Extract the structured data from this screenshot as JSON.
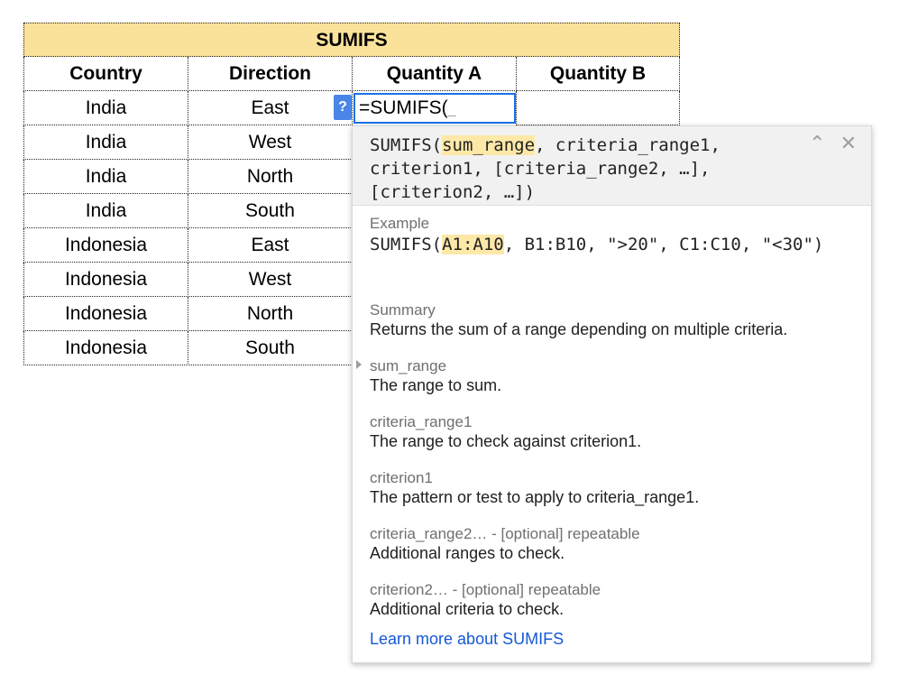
{
  "sheet": {
    "title": "SUMIFS",
    "headers": [
      "Country",
      "Direction",
      "Quantity A",
      "Quantity B"
    ],
    "rows": [
      [
        "India",
        "East"
      ],
      [
        "India",
        "West"
      ],
      [
        "India",
        "North"
      ],
      [
        "India",
        "South"
      ],
      [
        "Indonesia",
        "East"
      ],
      [
        "Indonesia",
        "West"
      ],
      [
        "Indonesia",
        "North"
      ],
      [
        "Indonesia",
        "South"
      ]
    ],
    "active_cell_value": "=SUMIFS(",
    "help_button": "?"
  },
  "popup": {
    "signature_prefix": "SUMIFS(",
    "signature_highlight": "sum_range",
    "signature_rest": ", criteria_range1, criterion1, [criteria_range2, …], [criterion2, …])",
    "collapse_icon": "chevron-up",
    "close_icon": "close",
    "example_label": "Example",
    "example_prefix": "SUMIFS(",
    "example_highlight": "A1:A10",
    "example_rest": ", B1:B10, \">20\", C1:C10, \"<30\")",
    "summary_label": "Summary",
    "summary_text": "Returns the sum of a range depending on multiple criteria.",
    "args": [
      {
        "name": "sum_range",
        "desc": "The range to sum."
      },
      {
        "name": "criteria_range1",
        "desc": "The range to check against criterion1."
      },
      {
        "name": "criterion1",
        "desc": "The pattern or test to apply to criteria_range1."
      },
      {
        "name": "criteria_range2… - [optional] repeatable",
        "desc": "Additional ranges to check."
      },
      {
        "name": "criterion2… - [optional] repeatable",
        "desc": "Additional criteria to check."
      }
    ],
    "learn_more": "Learn more about SUMIFS"
  }
}
